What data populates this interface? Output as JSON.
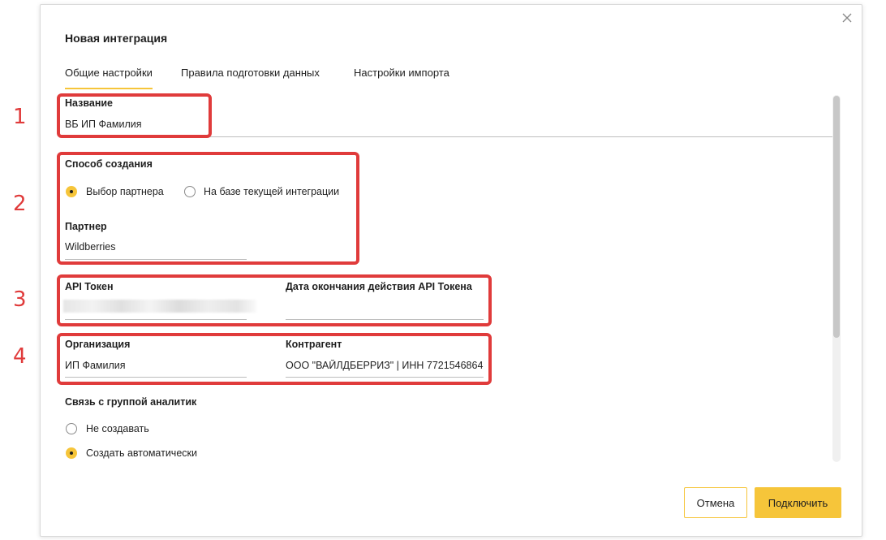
{
  "dialog": {
    "title": "Новая интеграция",
    "tabs": [
      {
        "label": "Общие настройки"
      },
      {
        "label": "Правила подготовки данных"
      },
      {
        "label": "Настройки импорта"
      }
    ]
  },
  "annotations": [
    "1",
    "2",
    "3",
    "4"
  ],
  "form": {
    "name": {
      "label": "Название",
      "value": "ВБ ИП Фамилия"
    },
    "creation_method": {
      "label": "Способ создания",
      "options": [
        {
          "label": "Выбор партнера",
          "checked": true
        },
        {
          "label": "На базе текущей интеграции",
          "checked": false
        }
      ]
    },
    "partner": {
      "label": "Партнер",
      "value": "Wildberries"
    },
    "api_token": {
      "label": "API Токен",
      "value": ""
    },
    "api_token_expiry": {
      "label": "Дата окончания действия API Токена",
      "value": ""
    },
    "organization": {
      "label": "Организация",
      "value": "ИП Фамилия"
    },
    "counterparty": {
      "label": "Контрагент",
      "value": "ООО \"ВАЙЛДБЕРРИЗ\" | ИНН 7721546864"
    },
    "analytics_group": {
      "label": "Связь с группой аналитик",
      "options": [
        {
          "label": "Не создавать",
          "checked": false
        },
        {
          "label": "Создать автоматически",
          "checked": true
        }
      ]
    }
  },
  "buttons": {
    "cancel": "Отмена",
    "connect": "Подключить"
  },
  "colors": {
    "accent": "#f6c53a",
    "highlight": "#e03b3b"
  }
}
